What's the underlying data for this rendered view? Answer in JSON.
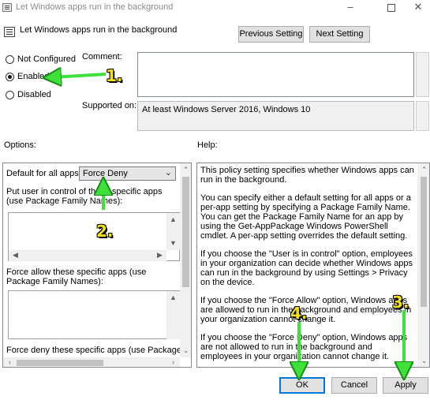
{
  "window": {
    "title": "Let Windows apps run in the background"
  },
  "header": {
    "setting_name": "Let Windows apps run in the background",
    "previous_label": "Previous Setting",
    "next_label": "Next Setting"
  },
  "state": {
    "options": [
      {
        "label": "Not Configured",
        "selected": false
      },
      {
        "label": "Enabled",
        "selected": true
      },
      {
        "label": "Disabled",
        "selected": false
      }
    ]
  },
  "comment_label": "Comment:",
  "supported_label": "Supported on:",
  "supported_value": "At least Windows Server 2016, Windows 10",
  "options_label": "Options:",
  "help_label": "Help:",
  "options_panel": {
    "default_label": "Default for all apps:",
    "default_value": "Force Deny",
    "user_control_label": "Put user in control of these specific apps (use Package Family Names):",
    "force_allow_label": "Force allow these specific apps (use Package Family Names):",
    "force_deny_label": "Force deny these specific apps (use Package Family"
  },
  "help_panel": {
    "paragraphs": [
      "This policy setting specifies whether Windows apps can run in the background.",
      "You can specify either a default setting for all apps or a per-app setting by specifying a Package Family Name. You can get the Package Family Name for an app by using the Get-AppPackage Windows PowerShell cmdlet. A per-app setting overrides the default setting.",
      "If you choose the \"User is in control\" option, employees in your organization can decide whether Windows apps can run in the background by using Settings > Privacy on the device.",
      "If you choose the \"Force Allow\" option, Windows apps are allowed to run in the background and employees in your organization cannot change it.",
      "If you choose the \"Force Deny\" option, Windows apps are not allowed to run in the background and employees in your organization cannot change it."
    ]
  },
  "footer": {
    "ok_label": "OK",
    "cancel_label": "Cancel",
    "apply_label": "Apply"
  },
  "annotations": {
    "step1": "1.",
    "step2": "2.",
    "step3": "3.",
    "step4": "4.",
    "arrow_color": "#3ee03a",
    "number_color": "#f0e01a"
  },
  "icons": [
    "policy-icon",
    "minimize-icon",
    "maximize-icon",
    "close-icon",
    "chevron-down-icon"
  ]
}
